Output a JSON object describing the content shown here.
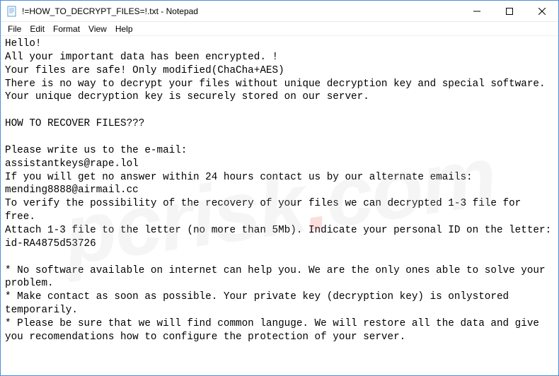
{
  "window": {
    "title": "!=HOW_TO_DECRYPT_FILES=!.txt - Notepad"
  },
  "menu": {
    "file": "File",
    "edit": "Edit",
    "format": "Format",
    "view": "View",
    "help": "Help"
  },
  "body": {
    "line1": "Hello!",
    "line2": "All your important data has been encrypted. !",
    "line3": "Your files are safe! Only modified(ChaCha+AES)",
    "line4": "There is no way to decrypt your files without unique decryption key and special software. Your unique decryption key is securely stored on our server.",
    "line5": "",
    "line6": "HOW TO RECOVER FILES???",
    "line7": "",
    "line8": "Please write us to the e-mail:",
    "line9": "assistantkeys@rape.lol",
    "line10": "If you will get no answer within 24 hours contact us by our alternate emails:",
    "line11": "mending8888@airmail.cc",
    "line12": "To verify the possibility of the recovery of your files we can decrypted 1-3 file for free.",
    "line13": "Attach 1-3 file to the letter (no more than 5Mb). Indicate your personal ID on the letter:",
    "line14": "id-RA4875d53726",
    "line15": "",
    "line16": "* No software available on internet can help you. We are the only ones able to solve your problem.",
    "line17": "* Make contact as soon as possible. Your private key (decryption key) is onlystored temporarily.",
    "line18": "* Please be sure that we will find common languge. We will restore all the data and give you recomendations how to configure the protection of your server."
  }
}
